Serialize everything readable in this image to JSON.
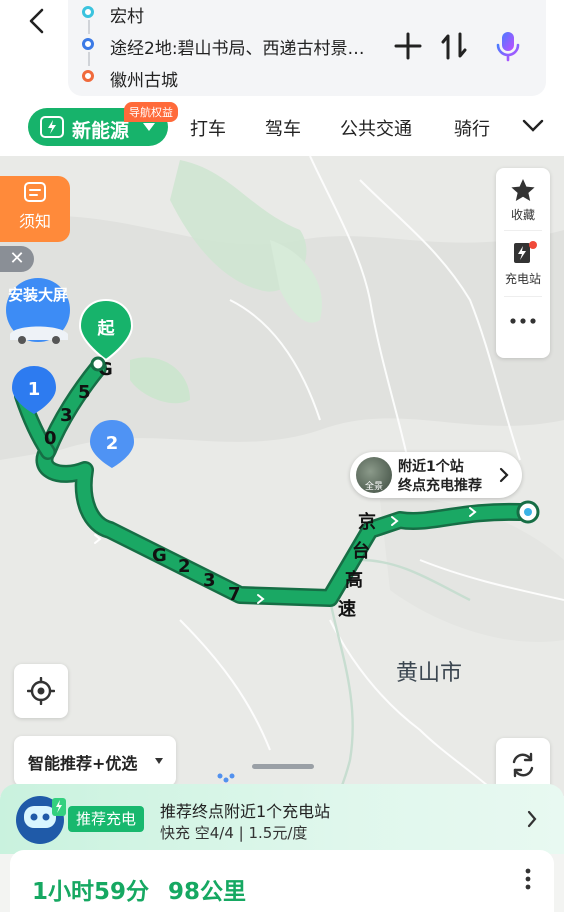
{
  "route": {
    "start": "宏村",
    "via": "途经2地:碧山书局、西递古村景…",
    "end": "徽州古城"
  },
  "tabs": {
    "new_energy": "新能源",
    "new_energy_badge": "导航权益",
    "items": [
      "打车",
      "驾车",
      "公共交通",
      "骑行"
    ]
  },
  "map": {
    "start_marker": "起",
    "waypoint_1": "1",
    "waypoint_2": "2",
    "road_g530": "G530",
    "road_g237": "G237",
    "road_expressway": "京台高速",
    "city_label": "黄山市",
    "charge_bubble_line1": "附近1个站",
    "charge_bubble_line2": "终点充电推荐",
    "charge_bubble_thumb": "全景"
  },
  "left_tools": {
    "notice": "须知",
    "install_big_screen": "安装大屏"
  },
  "side_tools": {
    "favorite": "收藏",
    "charging_station": "充电站"
  },
  "smart_pick": "智能推荐+优选",
  "charge_panel": {
    "tag": "推荐充电",
    "title": "推荐终点附近1个充电站",
    "detail": "快充 空4/4 | 1.5元/度"
  },
  "summary": {
    "duration": "1小时59分",
    "distance": "98公里"
  },
  "colors": {
    "route_green": "#1aa864",
    "accent_green": "#17b36b",
    "badge_orange": "#ff6a3a",
    "notice_orange": "#ff8a3a"
  }
}
